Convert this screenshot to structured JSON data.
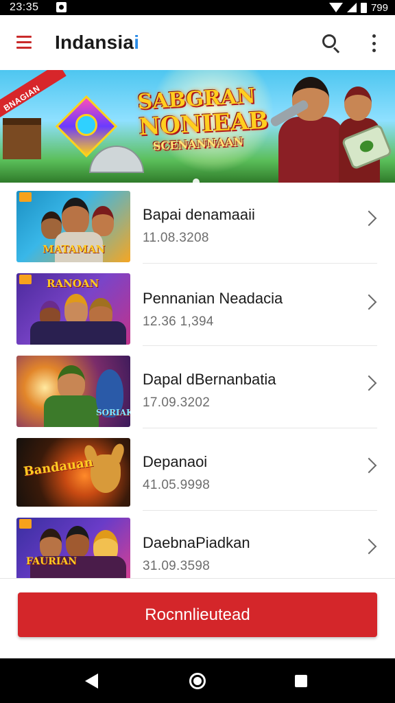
{
  "status_bar": {
    "time": "23:35",
    "battery": "799"
  },
  "app_bar": {
    "title_main": "Indansia",
    "title_accent": "i"
  },
  "banner": {
    "ribbon": "BNAGIAN",
    "title_line1": "SABGRAN",
    "title_line2": "NONIEAB",
    "title_line3": "SCENANNAAN"
  },
  "list": {
    "items": [
      {
        "title": "Bapai denamaaii",
        "subtitle": "11.08.3208",
        "thumb_logo": "MATAMAN",
        "thumb_colors": [
          "#1b8fc2",
          "#f5a623"
        ]
      },
      {
        "title": "Pennanian Neadacia",
        "subtitle": "12.36 1,394",
        "thumb_logo": "RANOAN",
        "thumb_colors": [
          "#4b2a9c",
          "#c2338a"
        ]
      },
      {
        "title": "Dapal dBernanbatia",
        "subtitle": "17.09.3202",
        "thumb_logo": "SORIAK",
        "thumb_colors": [
          "#5b1f78",
          "#e2862a"
        ]
      },
      {
        "title": "Depanaoi",
        "subtitle": "41.05.9998",
        "thumb_logo": "Bandauan",
        "thumb_colors": [
          "#14100c",
          "#c84a12"
        ]
      },
      {
        "title": "DaebnaPiadkan",
        "subtitle": "31.09.3598",
        "thumb_logo": "FAURIAN",
        "thumb_colors": [
          "#3a2fa0",
          "#e2418c"
        ]
      }
    ]
  },
  "footer": {
    "cta_label": "Rocnnlieutead"
  },
  "colors": {
    "accent_red": "#d4262a",
    "title_accent_blue": "#2b8be6",
    "menu_red": "#c92a2a"
  }
}
